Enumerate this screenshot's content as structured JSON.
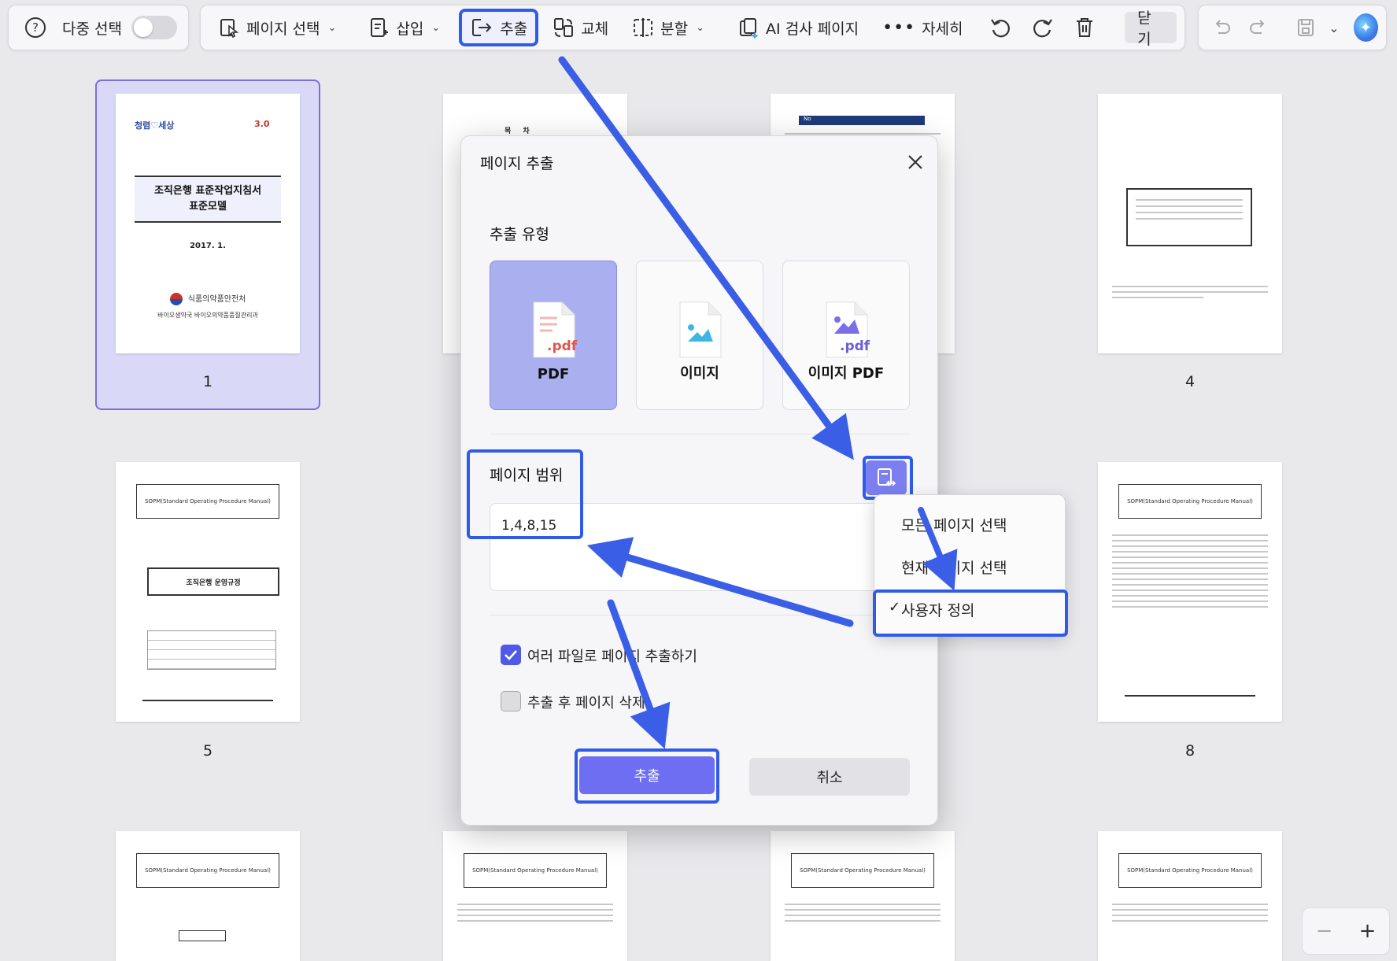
{
  "toolbar": {
    "help_icon": "question-circle-icon",
    "multi_select_label": "다중 선택",
    "page_select_label": "페이지 선택",
    "insert_label": "삽입",
    "extract_label": "추출",
    "replace_label": "교체",
    "split_label": "분할",
    "ai_label": "AI 검사 페이지",
    "more_label": "자세히",
    "close_label": "닫기"
  },
  "thumbnails": {
    "cover": {
      "logo_left": "청렴♡세상",
      "title_line1": "조직은행 표준작업지침서",
      "title_line2": "표준모델",
      "date": "2017. 1.",
      "org1": "식품의약품안전처",
      "org2": "바이오생약국 바이오의약품품질관리과"
    },
    "toc_title": "목 차",
    "sop_header": "SOPM(Standard Operating Procedure Manual)",
    "page5_box": "조직은행 운영규정",
    "table_header": "No"
  },
  "page_numbers": [
    "1",
    "4",
    "5",
    "8"
  ],
  "modal": {
    "title": "페이지 추출",
    "type_label": "추출 유형",
    "types": [
      {
        "label": "PDF",
        "selected": true
      },
      {
        "label": "이미지",
        "selected": false
      },
      {
        "label": "이미지 PDF",
        "selected": false
      }
    ],
    "pdf_ext": ".pdf",
    "range_label": "페이지 범위",
    "range_value": "1,4,8,15",
    "options": [
      {
        "label": "여러 파일로 페이지 추출하기",
        "checked": true
      },
      {
        "label": "추출 후 페이지 삭제",
        "checked": false
      }
    ],
    "extract_button": "추출",
    "cancel_button": "취소"
  },
  "dropdown": {
    "items": [
      {
        "label": "모든 페이지 선택",
        "selected": false
      },
      {
        "label": "현재 페이지 선택",
        "selected": false
      },
      {
        "label": "사용자 정의",
        "selected": true
      }
    ],
    "check_mark": "✓"
  },
  "zoom": {
    "minus": "−",
    "plus": "+"
  },
  "colors": {
    "accent": "#2f5be8",
    "primary": "#6d6ef2",
    "selected_card": "#aab0ef",
    "annotation_arrow": "#3a5fe6"
  }
}
